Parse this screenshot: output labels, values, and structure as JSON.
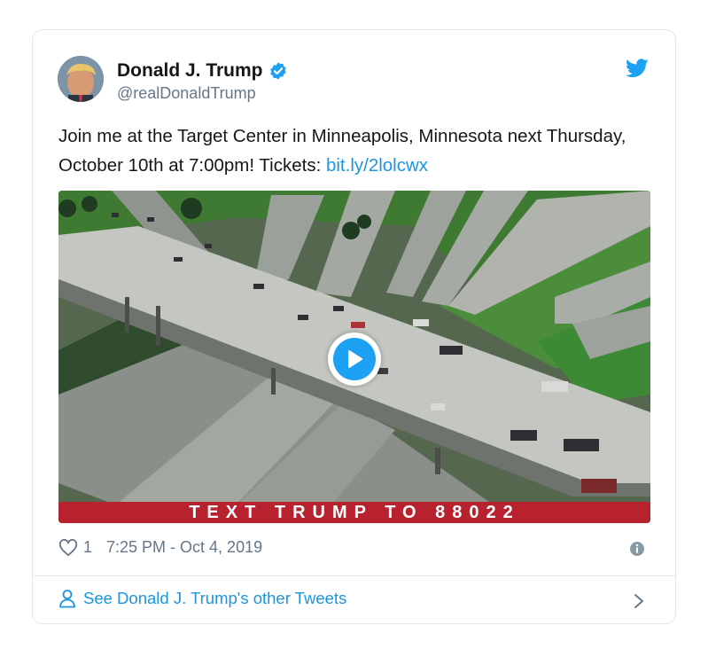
{
  "tweet": {
    "display_name": "Donald J. Trump",
    "handle": "@realDonaldTrump",
    "text_before_link": "Join me at the Target Center in Minneapolis, Minnesota next Thursday, October 10th at 7:00pm! Tickets: ",
    "link_text": "bit.ly/2lolcwx",
    "media": {
      "banner_text": "TEXT TRUMP TO 88022"
    },
    "like_count": "1",
    "timestamp": "7:25 PM - Oct 4, 2019"
  },
  "footer": {
    "other_tweets_label": "See Donald J. Trump's other Tweets"
  },
  "icons": {
    "verified": "verified-badge-icon",
    "brand": "twitter-bird-icon",
    "like": "heart-icon",
    "info": "info-icon",
    "person": "person-icon",
    "chevron": "chevron-right-icon",
    "play": "play-icon"
  },
  "colors": {
    "link": "#1b95e0",
    "brand_blue": "#1da1f2",
    "banner_red": "#b8222f",
    "muted_text": "#657786",
    "border": "#e1e8ed"
  }
}
